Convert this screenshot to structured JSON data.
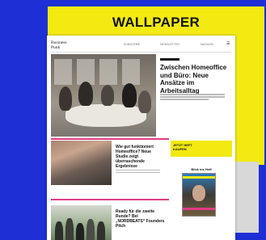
{
  "banner": {
    "title": "WALLPAPER"
  },
  "site": {
    "logo": "Business Punk",
    "nav": [
      "SUBSCRIBE",
      "NEWSLETTER",
      "MAGAZIN"
    ]
  },
  "hero": {
    "title": "Zwischen Homeoffice und Büro: Neue Ansätze im Arbeitsalltag"
  },
  "article2": {
    "title": "Wie gut funktioniert Homeoffice? Neue Studie zeigt überraschende Ergebnisse"
  },
  "promo": {
    "label": "JETZT HEFT KAUFEN",
    "issue_label": "Blick ins Heft"
  },
  "article3": {
    "title": "Ready für die zweite Runde? Bei „NORDBEATS“ Founders Pitch"
  },
  "colors": {
    "accent_yellow": "#f2ea10",
    "accent_pink": "#e23c86",
    "background_blue": "#1f2fd6"
  }
}
